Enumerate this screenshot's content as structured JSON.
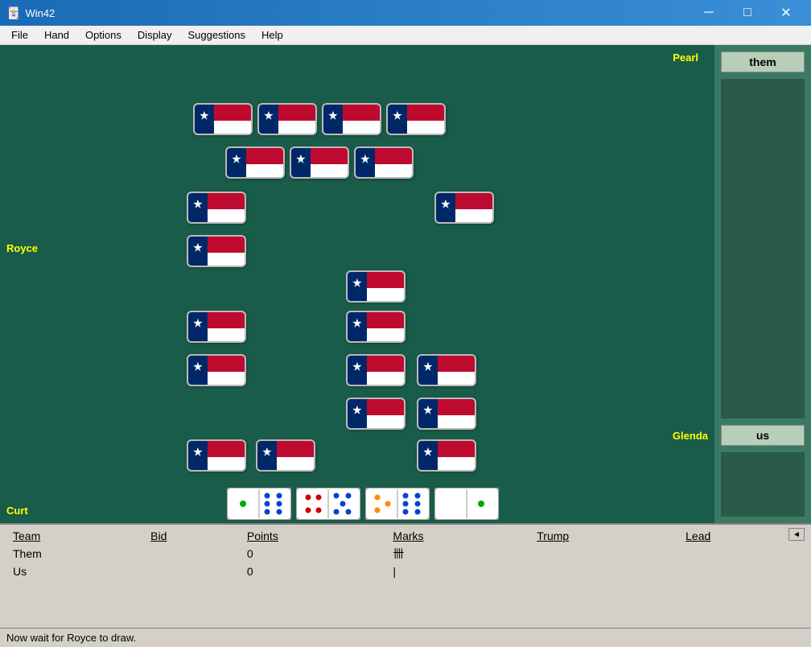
{
  "window": {
    "title": "Win42",
    "icon": "♠"
  },
  "menu": {
    "items": [
      "File",
      "Hand",
      "Options",
      "Display",
      "Suggestions",
      "Help"
    ]
  },
  "players": {
    "top": "Pearl",
    "left": "Royce",
    "right": "Glenda",
    "bottom": "Curt"
  },
  "side_panel": {
    "them_label": "them",
    "us_label": "us"
  },
  "score_table": {
    "headers": [
      "Team",
      "Bid",
      "Points",
      "Marks",
      "Trump",
      "Lead"
    ],
    "rows": [
      {
        "team": "Them",
        "bid": "",
        "points": "0",
        "marks": "卌",
        "trump": "",
        "lead": ""
      },
      {
        "team": "Us",
        "bid": "",
        "points": "0",
        "marks": "|",
        "trump": "",
        "lead": ""
      }
    ]
  },
  "status": {
    "message": "Now wait for Royce to draw."
  },
  "title_controls": {
    "minimize": "─",
    "maximize": "□",
    "close": "✕"
  }
}
